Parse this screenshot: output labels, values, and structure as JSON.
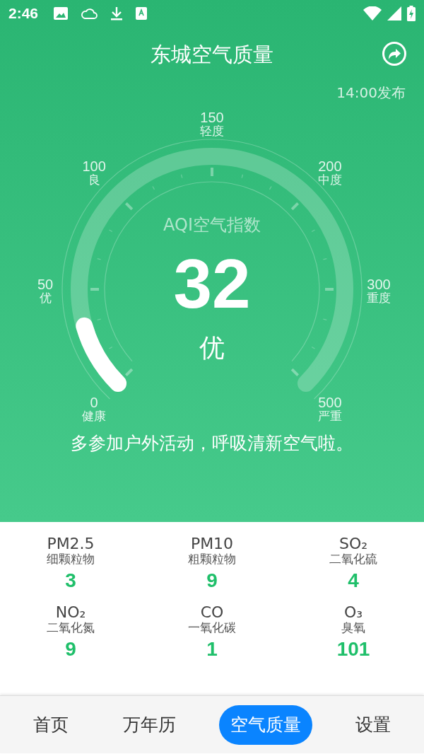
{
  "status_bar": {
    "time": "2:46"
  },
  "header": {
    "title": "东城空气质量",
    "publish_time": "14:00发布"
  },
  "gauge": {
    "caption": "AQI空气指数",
    "value": "32",
    "grade": "优",
    "scale": [
      {
        "value": "0",
        "label": "健康"
      },
      {
        "value": "50",
        "label": "优"
      },
      {
        "value": "100",
        "label": "良"
      },
      {
        "value": "150",
        "label": "轻度"
      },
      {
        "value": "200",
        "label": "中度"
      },
      {
        "value": "300",
        "label": "重度"
      },
      {
        "value": "500",
        "label": "严重"
      }
    ]
  },
  "advice": "多参加户外活动，呼吸清新空气啦。",
  "pollutants": [
    {
      "name": "PM2.5",
      "description": "细颗粒物",
      "value": "3"
    },
    {
      "name": "PM10",
      "description": "粗颗粒物",
      "value": "9"
    },
    {
      "name": "SO₂",
      "description": "二氧化硫",
      "value": "4"
    },
    {
      "name": "NO₂",
      "description": "二氧化氮",
      "value": "9"
    },
    {
      "name": "CO",
      "description": "一氧化碳",
      "value": "1"
    },
    {
      "name": "O₃",
      "description": "臭氧",
      "value": "101"
    }
  ],
  "tabs": [
    {
      "label": "首页",
      "selected": false
    },
    {
      "label": "万年历",
      "selected": false
    },
    {
      "label": "空气质量",
      "selected": true
    },
    {
      "label": "设置",
      "selected": false
    }
  ]
}
